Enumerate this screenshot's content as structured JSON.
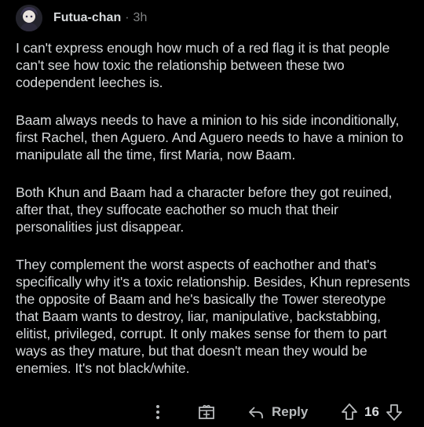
{
  "comment": {
    "author": "Futua-chan",
    "separator": "·",
    "time": "3h",
    "paragraphs": [
      "I can't express enough how much of a red flag it is that people can't see how toxic the relationship between these two codependent leeches is.",
      "Baam always needs to have a minion to his side inconditionally, first Rachel, then Aguero. And Aguero needs to have a minion to manipulate all the time, first Maria, now Baam.",
      "Both Khun and Baam had a character before they got reuined, after that, they suffocate eachother so much that their personalities just disappear.",
      "They complement the worst aspects of eachother and that's specifically why it's a toxic relationship. Besides, Khun represents the opposite of Baam and he's basically the Tower stereotype that Baam wants to destroy, liar, manipulative, backstabbing, elitist, privileged, corrupt. It only makes sense for them to part ways as they mature, but that doesn't mean they would be enemies. It's not black/white."
    ]
  },
  "actions": {
    "more_icon": "more-vertical-icon",
    "award_icon": "award-gift-icon",
    "reply_icon": "reply-arrow-icon",
    "reply_label": "Reply",
    "upvote_icon": "upvote-arrow-icon",
    "vote_count": "16",
    "downvote_icon": "downvote-arrow-icon"
  },
  "colors": {
    "background": "#000000",
    "text": "#d7dadc",
    "muted": "#818384"
  }
}
